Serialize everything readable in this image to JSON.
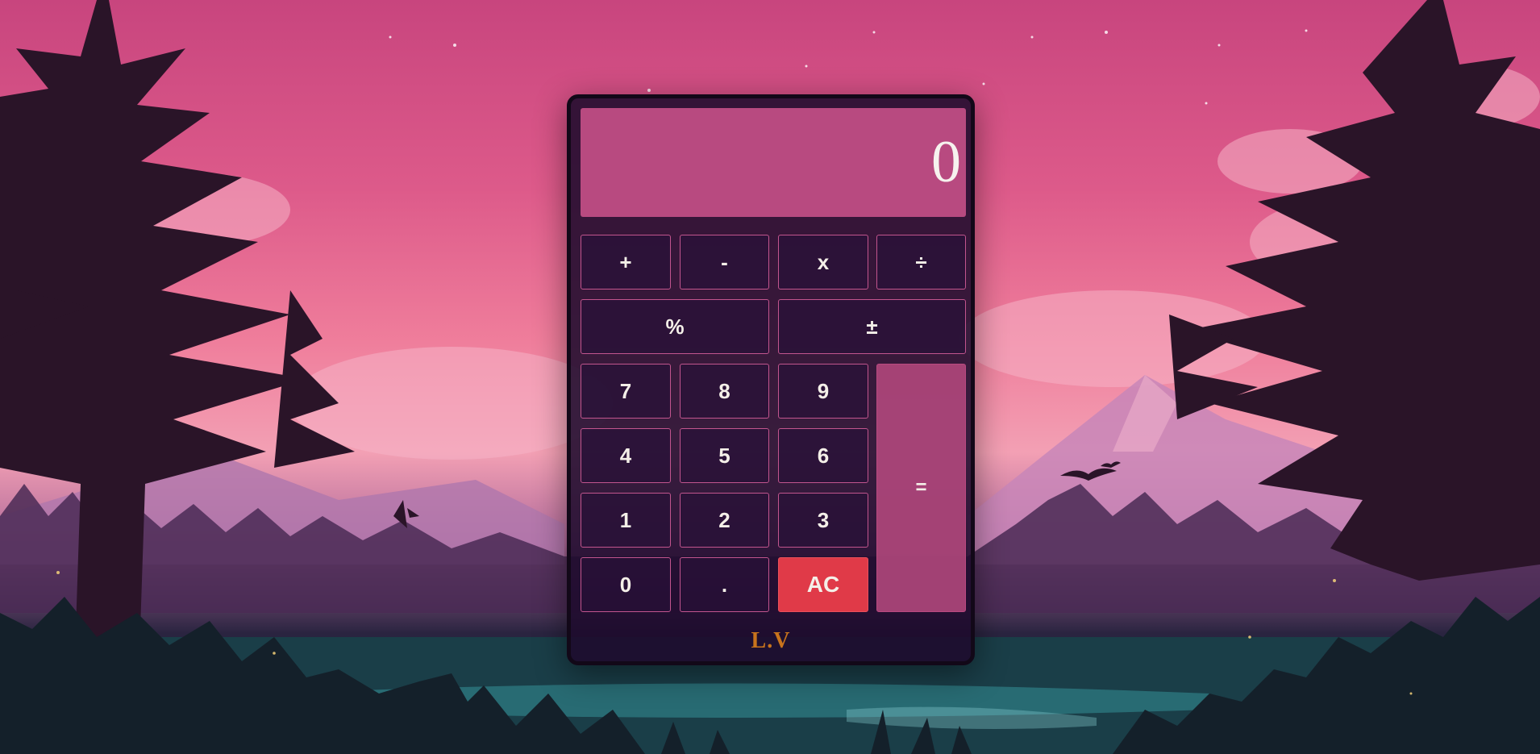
{
  "calculator": {
    "display_value": "0",
    "keys": {
      "plus": "+",
      "minus": "-",
      "multiply": "x",
      "divide": "÷",
      "percent": "%",
      "plus_minus": "±",
      "seven": "7",
      "eight": "8",
      "nine": "9",
      "four": "4",
      "five": "5",
      "six": "6",
      "one": "1",
      "two": "2",
      "three": "3",
      "zero": "0",
      "decimal": ".",
      "clear": "AC",
      "equals": "="
    },
    "brand": "L.V"
  },
  "colors": {
    "display_bg": "#b84a80",
    "key_border": "#c2558e",
    "clear_bg": "#e03a48",
    "brand": "#c8741c",
    "body_bg": "#1e0a2c"
  }
}
